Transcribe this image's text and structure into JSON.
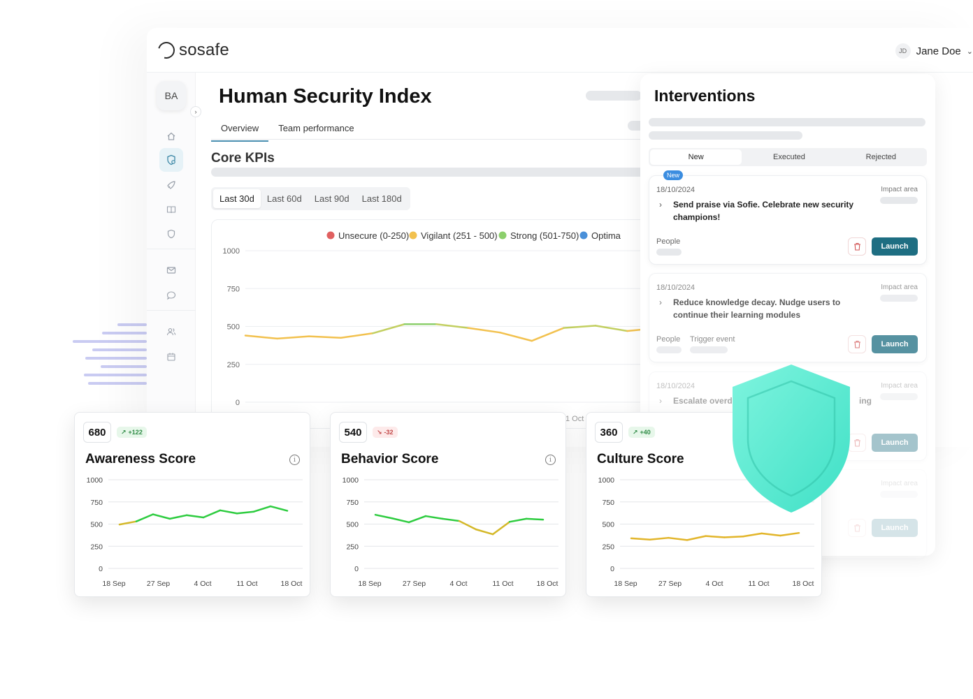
{
  "brand": {
    "name": "sosafe"
  },
  "user": {
    "initials": "JD",
    "name": "Jane Doe"
  },
  "sidebar": {
    "workspace": "BA"
  },
  "page": {
    "title": "Human Security Index"
  },
  "tabs": [
    {
      "label": "Overview"
    },
    {
      "label": "Team performance"
    }
  ],
  "kpi": {
    "title": "Core KPIs",
    "ranges": [
      "Last 30d",
      "Last 60d",
      "Last 90d",
      "Last 180d"
    ],
    "legend": [
      "Unsecure (0-250)",
      "Vigilant (251 - 500)",
      "Strong (501-750)",
      "Optima"
    ],
    "legend_colors": [
      "#e06060",
      "#f2c14e",
      "#8ccf6c",
      "#4a90d9"
    ],
    "yticks": [
      "1000",
      "750",
      "500",
      "250",
      "0"
    ],
    "partial_xlabel": "1 Oct"
  },
  "interventions": {
    "title": "Interventions",
    "tabs": [
      "New",
      "Executed",
      "Rejected"
    ],
    "cards": [
      {
        "badge": "New",
        "date": "18/10/2024",
        "impact_label": "Impact area",
        "text": "Send praise via Sofie. Celebrate new security champions!",
        "people_label": "People",
        "trigger_label": "",
        "launch": "Launch"
      },
      {
        "badge": "",
        "date": "18/10/2024",
        "impact_label": "Impact area",
        "text": "Reduce knowledge decay. Nudge users to continue their learning modules",
        "people_label": "People",
        "trigger_label": "Trigger event",
        "launch": "Launch"
      },
      {
        "badge": "",
        "date": "18/10/2024",
        "impact_label": "Impact area",
        "text": "Escalate overd",
        "text_tail": "ing",
        "people_label": "",
        "trigger_label": "",
        "launch": "Launch"
      },
      {
        "badge": "",
        "date": "",
        "impact_label": "Impact area",
        "text": "",
        "people_label": "",
        "trigger_label": "",
        "launch": "Launch"
      }
    ]
  },
  "scores": [
    {
      "value": "680",
      "delta": "+122",
      "trend": "up",
      "title": "Awareness Score"
    },
    {
      "value": "540",
      "delta": "-32",
      "trend": "down",
      "title": "Behavior Score"
    },
    {
      "value": "360",
      "delta": "+40",
      "trend": "up",
      "title": "Culture Score"
    }
  ],
  "chart_data": [
    {
      "type": "line",
      "title": "Core KPIs",
      "ylim": [
        0,
        1000
      ],
      "yticks": [
        0,
        250,
        500,
        750,
        1000
      ],
      "series": [
        {
          "values": [
            440,
            420,
            435,
            425,
            455,
            515,
            515,
            490,
            460,
            405,
            490,
            505,
            470,
            490
          ]
        }
      ]
    },
    {
      "type": "line",
      "title": "Awareness Score",
      "categories": [
        "18 Sep",
        "27 Sep",
        "4 Oct",
        "11 Oct",
        "18 Oct"
      ],
      "ylim": [
        0,
        1000
      ],
      "yticks": [
        0,
        250,
        500,
        750,
        1000
      ],
      "series": [
        {
          "values": [
            495,
            530,
            610,
            560,
            600,
            575,
            655,
            620,
            640,
            700,
            650
          ]
        }
      ],
      "color": "#2ecc40"
    },
    {
      "type": "line",
      "title": "Behavior Score",
      "categories": [
        "18 Sep",
        "27 Sep",
        "4 Oct",
        "11 Oct",
        "18 Oct"
      ],
      "ylim": [
        0,
        1000
      ],
      "yticks": [
        0,
        250,
        500,
        750,
        1000
      ],
      "series": [
        {
          "values": [
            605,
            565,
            520,
            590,
            560,
            535,
            440,
            385,
            525,
            560,
            550
          ]
        }
      ],
      "color": "#2ecc40"
    },
    {
      "type": "line",
      "title": "Culture Score",
      "categories": [
        "18 Sep",
        "27 Sep",
        "4 Oct",
        "11 Oct",
        "18 Oct"
      ],
      "ylim": [
        0,
        1000
      ],
      "yticks": [
        0,
        250,
        500,
        750,
        1000
      ],
      "series": [
        {
          "values": [
            340,
            325,
            345,
            320,
            365,
            350,
            360,
            395,
            370,
            400
          ]
        }
      ],
      "color": "#e2b52a"
    }
  ]
}
